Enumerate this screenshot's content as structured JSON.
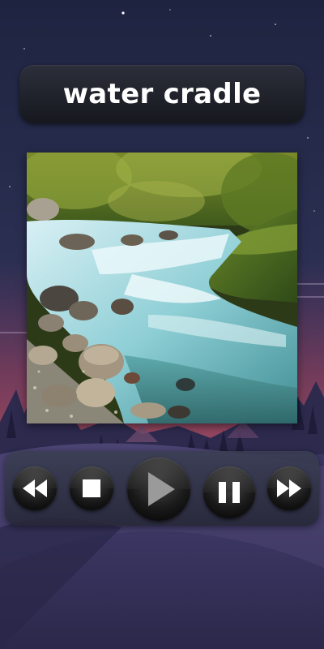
{
  "screen": {
    "title": "water cradle"
  },
  "artwork": {
    "subject": "mountain-stream-photo"
  },
  "controls": {
    "rewind": "rewind-icon",
    "stop": "stop-icon",
    "play": "play-icon",
    "pause": "pause-icon",
    "forward": "fast-forward-icon"
  },
  "colors": {
    "background_top": "#1e2440",
    "background_bottom": "#4a4270",
    "pill": "#16181e",
    "title_text": "#ffffff",
    "button_black": "#000000",
    "button_glyph": "#ffffff",
    "play_glyph": "#9a9a9a"
  }
}
